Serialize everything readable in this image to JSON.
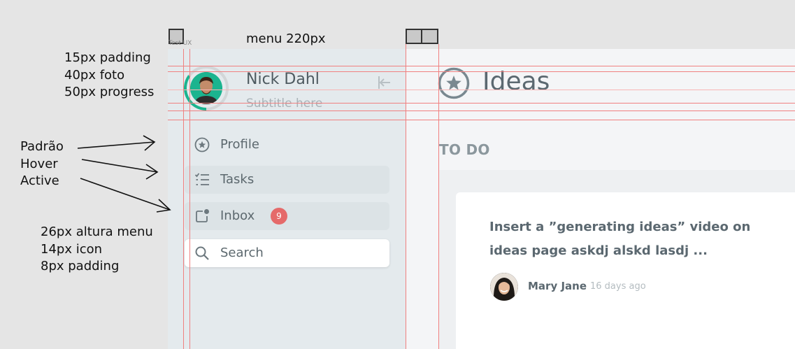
{
  "annotations": {
    "menu_width": "menu 220px",
    "spacing": [
      "15px padding",
      "40px foto",
      "50px progress"
    ],
    "states": [
      "Padrão",
      "Hover",
      "Active"
    ],
    "specs": [
      "26px altura menu",
      "14px icon",
      "8px padding"
    ],
    "frame_label": "Test UX"
  },
  "profile": {
    "name": "Nick Dahl",
    "subtitle": "Subtitle here",
    "progress": 0.35,
    "ring_color": "#1bb48f"
  },
  "menu": {
    "items": [
      {
        "label": "Profile",
        "icon": "star-circle-icon",
        "state": "default"
      },
      {
        "label": "Tasks",
        "icon": "checklist-icon",
        "state": "hover"
      },
      {
        "label": "Inbox",
        "icon": "inbox-icon",
        "state": "active",
        "badge": "9"
      },
      {
        "label": "Search",
        "icon": "search-icon",
        "state": "search"
      }
    ]
  },
  "page": {
    "title": "Ideas",
    "title_icon": "star-circle-icon",
    "section": "TO DO"
  },
  "card": {
    "text": "Insert a ”generating ideas” video on ideas page askdj alskd lasdj ...",
    "author": "Mary Jane",
    "time": "16 days ago"
  },
  "colors": {
    "guide_line": "#f08080",
    "sidebar_bg": "#e4eaed",
    "main_bg": "#f4f5f7",
    "badge": "#e56a6a",
    "accent": "#1bb48f"
  }
}
